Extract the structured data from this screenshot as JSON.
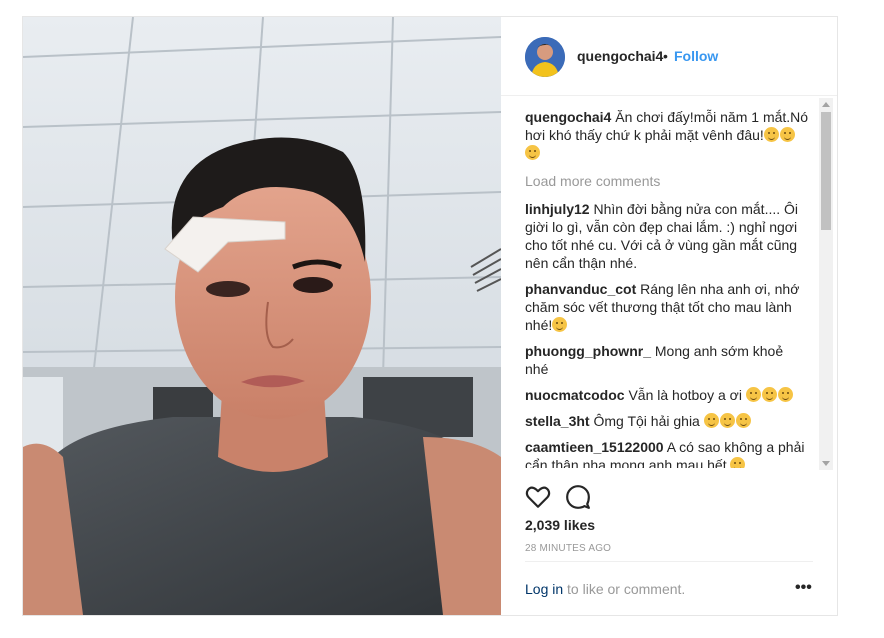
{
  "post": {
    "username": "quengochai4",
    "separator": "•",
    "follow_label": "Follow",
    "caption_user": "quengochai4",
    "caption_text": "Ăn chơi đấy!mỗi năm 1 mắt.Nó hơi khó thấy chứ k phải mặt vênh đâu!",
    "load_more": "Load more comments",
    "comments": [
      {
        "user": "linhjuly12",
        "text": "Nhìn đời bằng nửa con mắt.... Ôi giời lo gì, vẫn còn đẹp chai lắm. :) nghỉ ngơi cho tốt nhé cu. Với cả ở vùng gần mắt cũng nên cẩn thận nhé."
      },
      {
        "user": "phanvanduc_cot",
        "text": "Ráng lên nha anh ơi, nhớ chăm sóc vết thương thật tốt cho mau lành nhé!"
      },
      {
        "user": "phuongg_phownr_",
        "text": "Mong anh sớm khoẻ nhé"
      },
      {
        "user": "nuocmatcodoc",
        "text": "Vẫn là hotboy a ơi"
      },
      {
        "user": "stella_3ht",
        "text": "Ômg Tội hải ghia"
      },
      {
        "user": "caamtieen_15122000",
        "text": "A có sao không a phải cẩn thận nha mong anh mau hết"
      }
    ],
    "likes": "2,039 likes",
    "time": "28 MINUTES AGO",
    "login_link": "Log in",
    "login_rest": " to like or comment.",
    "more_label": "•••"
  },
  "icons": {
    "heart": "heart-icon",
    "comment": "comment-icon",
    "more": "more-options-icon"
  },
  "colors": {
    "follow": "#3897f0",
    "muted": "#999999",
    "text": "#262626",
    "login_link": "#003569"
  }
}
